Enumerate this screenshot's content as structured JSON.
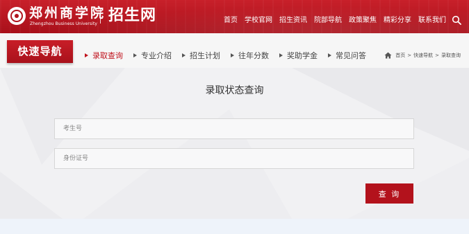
{
  "header": {
    "school_name": "郑州商学院",
    "school_name_en": "Zhengzhou Business University",
    "site_name": "招生网",
    "nav": [
      "首页",
      "学校官网",
      "招生资讯",
      "院部导航",
      "政策聚焦",
      "精彩分享",
      "联系我们"
    ],
    "search_icon": "search-icon"
  },
  "quicknav": {
    "title": "快速导航",
    "items": [
      "录取查询",
      "专业介绍",
      "招生计划",
      "往年分数",
      "奖助学金",
      "常见问答"
    ],
    "active_index": 0,
    "breadcrumb": [
      "首页",
      "快速导航",
      "录取查询"
    ],
    "breadcrumb_separator": ">"
  },
  "main": {
    "title": "录取状态查询",
    "exam_no_placeholder": "考生号",
    "id_no_placeholder": "身份证号",
    "submit_label": "查 询"
  },
  "colors": {
    "brand_red": "#b3121c",
    "active_text": "#c0141e",
    "page_bg": "#f1f1f3"
  }
}
